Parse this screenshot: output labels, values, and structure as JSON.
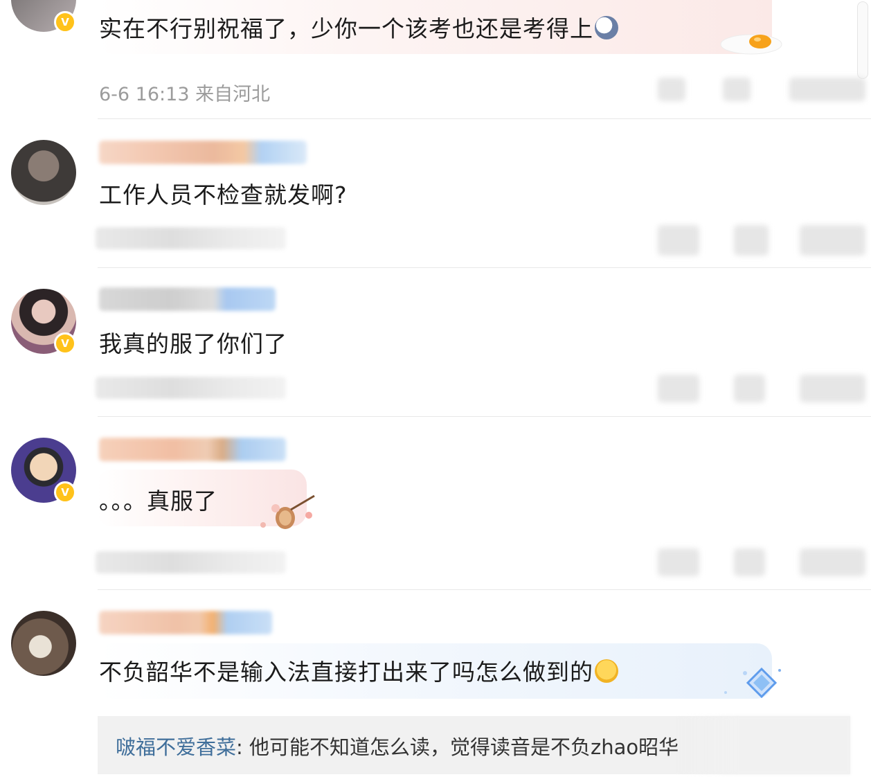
{
  "comments": [
    {
      "text": "实在不行别祝福了，少你一个该考也还是考得上",
      "meta": "6-6 16:13 来自河北",
      "verified": true
    },
    {
      "text": "工作人员不检查就发啊?",
      "verified": false
    },
    {
      "text": "我真的服了你们了",
      "verified": true
    },
    {
      "text": "。。。真服了",
      "verified": true
    },
    {
      "text": "不负韶华不是输入法直接打出来了吗怎么做到的",
      "verified": false
    }
  ],
  "reply": {
    "author": "啵福不爱香菜",
    "separator": ": ",
    "text": "他可能不知道怎么读，觉得读音是不负zhao昭华"
  },
  "icons": {
    "verified": "verified-badge-icon",
    "emoji_panda": "panda-emoji-icon",
    "emoji_laugh": "laugh-cry-emoji-icon",
    "egg": "fried-egg-decoration",
    "pipa": "pipa-flower-decoration",
    "diamond": "diamond-decoration"
  },
  "colors": {
    "verified_badge": "#ffc21a",
    "reply_author": "#3f6e9a",
    "meta_text": "#9b9b9b",
    "divider": "#e8e8e8"
  }
}
